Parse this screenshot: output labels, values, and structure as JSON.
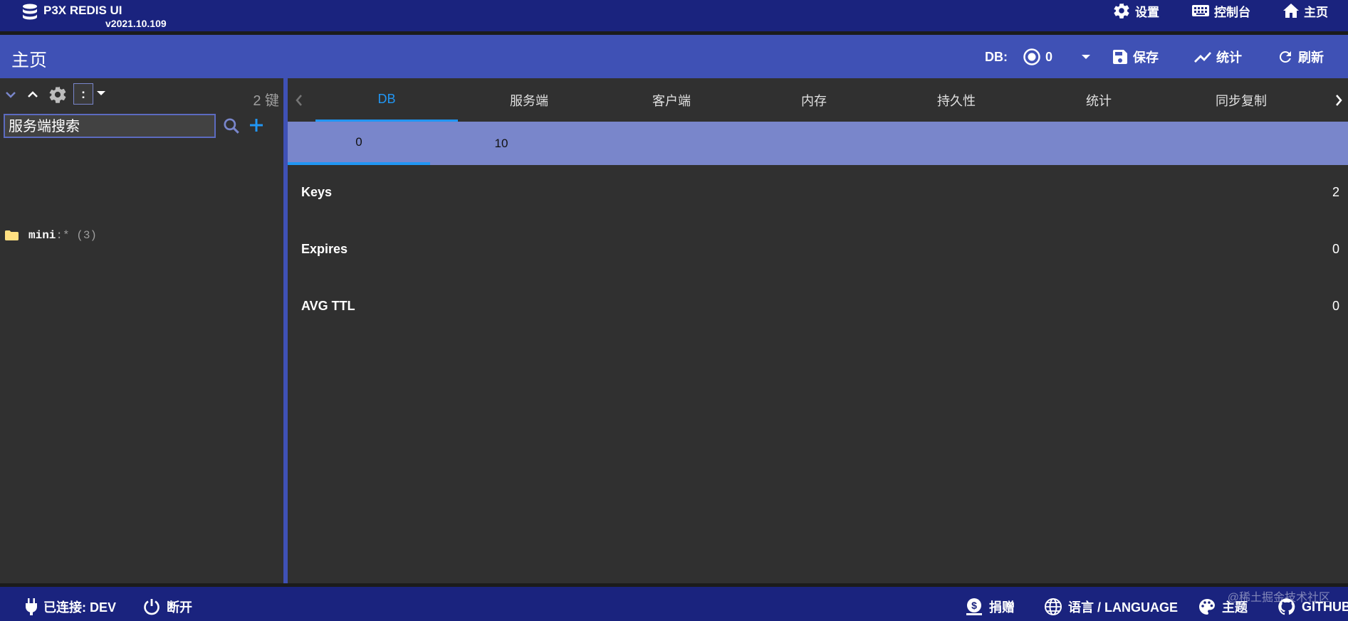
{
  "app": {
    "name": "P3X REDIS UI",
    "version": "v2021.10.109"
  },
  "topnav": {
    "settings": "设置",
    "console": "控制台",
    "home": "主页"
  },
  "header": {
    "title": "主页",
    "db_label": "DB:",
    "db_value": "0",
    "save": "保存",
    "statistics": "统计",
    "refresh": "刷新"
  },
  "sidebar": {
    "key_count": "2 键",
    "divider": ":",
    "search_placeholder": "服务端搜索",
    "tree": [
      {
        "prefix": "mini",
        "separator": ":*",
        "count": "(3)"
      }
    ]
  },
  "tabs": [
    "DB",
    "服务端",
    "客户端",
    "内存",
    "持久性",
    "统计",
    "同步复制"
  ],
  "active_tab": "DB",
  "db_subtabs": [
    "0",
    "10"
  ],
  "active_subtab": "0",
  "stats": [
    {
      "label": "Keys",
      "value": "2"
    },
    {
      "label": "Expires",
      "value": "0"
    },
    {
      "label": "AVG TTL",
      "value": "0"
    }
  ],
  "footer": {
    "connection": "已连接: DEV",
    "disconnect": "断开",
    "donate": "捐赠",
    "language": "语言 / LANGUAGE",
    "theme": "主题",
    "github": "GITHUB"
  },
  "watermark": "@稀土掘金技术社区",
  "colors": {
    "topbar": "#1a237e",
    "header": "#3f51b5",
    "subtabs": "#7986cb",
    "accent": "#2196f3",
    "background": "#303030"
  }
}
